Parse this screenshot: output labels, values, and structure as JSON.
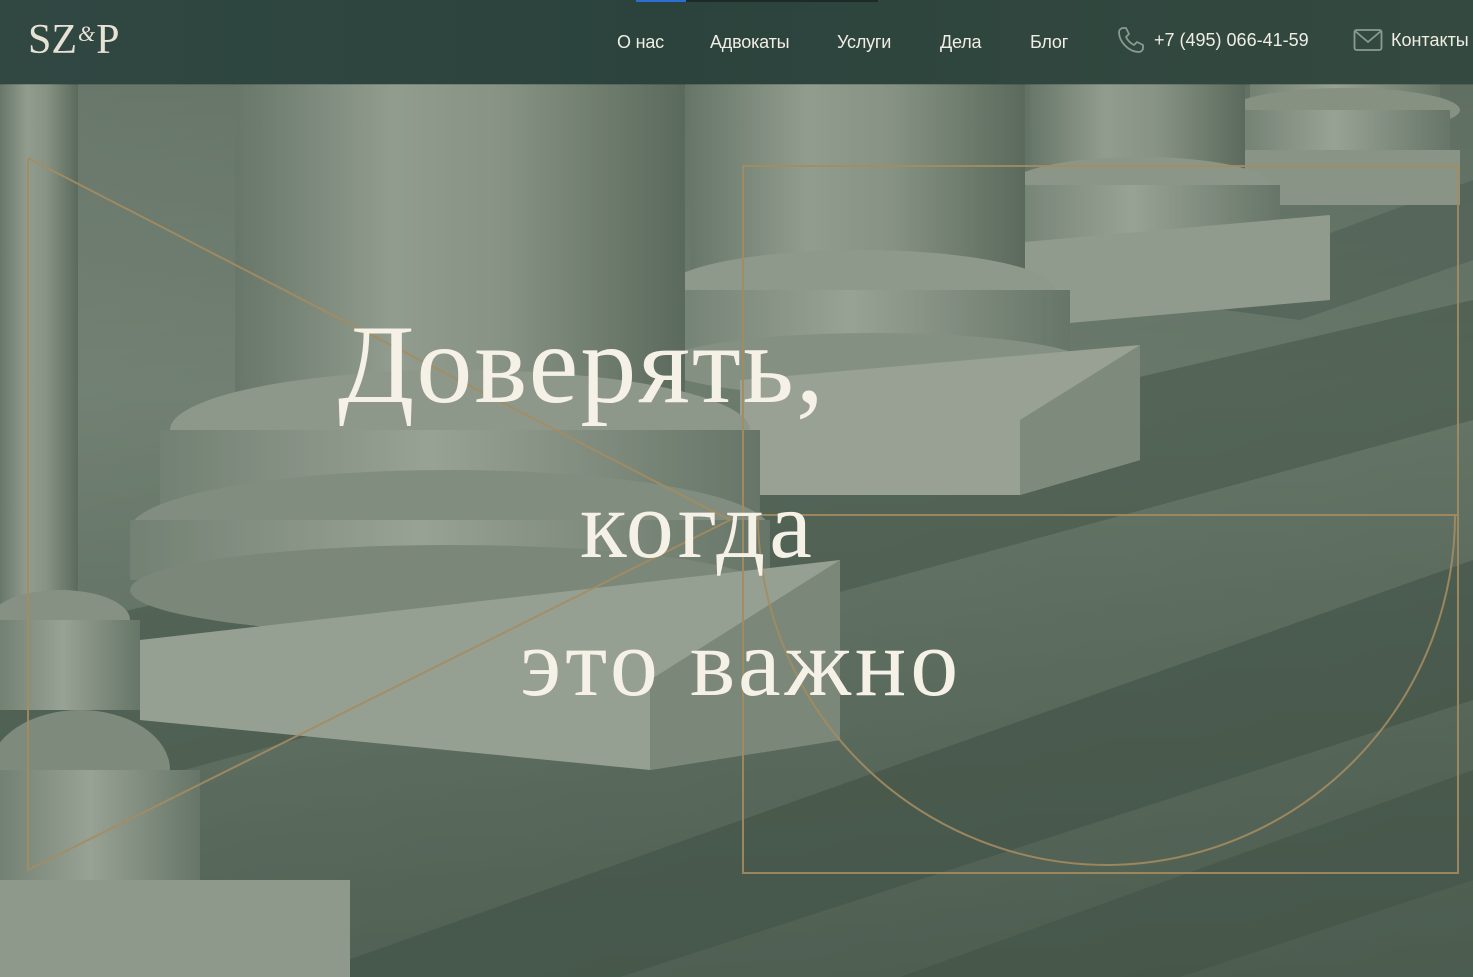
{
  "header": {
    "logo": {
      "left": "SZ",
      "amp": "&",
      "right": "P"
    },
    "nav": [
      {
        "label": "О нас"
      },
      {
        "label": "Адвокаты"
      },
      {
        "label": "Услуги"
      },
      {
        "label": "Дела"
      },
      {
        "label": "Блог"
      }
    ],
    "phone": {
      "icon": "phone-icon",
      "text": "+7 (495) 066-41-59"
    },
    "contacts": {
      "icon": "envelope-icon",
      "label": "Контакты"
    }
  },
  "hero": {
    "headline_lines": [
      "Доверять,",
      "когда",
      "это важно"
    ],
    "background": "classical-columns-photo"
  },
  "colors": {
    "header_bg": "#2e453f",
    "headline": "#f6f1e6",
    "gold_line": "#a48c60",
    "accent_blue": "#2d6fd0"
  }
}
